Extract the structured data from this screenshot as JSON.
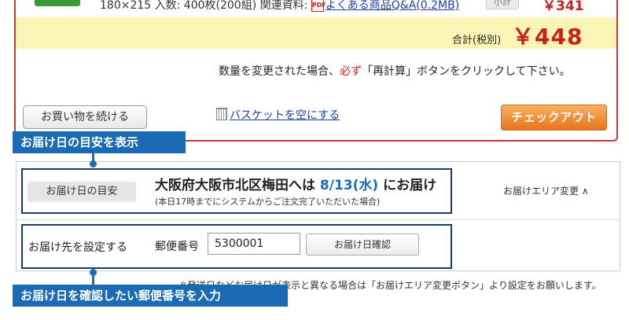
{
  "product": {
    "meta_text": "180×215 入数: 400枚(200組) 関連資料:",
    "pdf_label": "PDF",
    "faq_link": "よくある商品Q&A(0.2MB)",
    "subtotal_label": "小計",
    "subtotal_price": "￥341"
  },
  "totals": {
    "label": "合計(税別)",
    "price": "￥448"
  },
  "notice": {
    "before": "数量を変更された場合、",
    "must": "必ず",
    "after": "「再計算」ボタンをクリックして下さい。"
  },
  "actions": {
    "continue_label": "お買い物を続ける",
    "empty_basket_label": "バスケットを空にする",
    "checkout_label": "チェックアウト"
  },
  "callouts": {
    "estimate_tag": "お届け日の目安を表示",
    "zip_tag": "お届け日を確認したい郵便番号を入力"
  },
  "delivery": {
    "estimate_label": "お届け日の目安",
    "destination": "大阪府大阪市北区梅田",
    "to": "へは",
    "date": "8/13(水)",
    "suffix": "にお届け",
    "sub_note": "(本日17時までにシステムからご注文完了いただいた場合)",
    "area_change": "お届けエリア変更 ∧",
    "set_label": "お届け先を設定する",
    "zip_label": "郵便番号",
    "zip_value": "5300001",
    "confirm_label": "お届け日確認",
    "bottom_note": "※発送日などお届け日が表示と異なる場合は「お届けエリア変更ボタン」より設定をお願いします。"
  },
  "colors": {
    "accent_red": "#c8201f",
    "callout_blue": "#1a6bb3",
    "total_bar_yellow": "#faf5b4",
    "checkout_orange": "#e6751b"
  }
}
